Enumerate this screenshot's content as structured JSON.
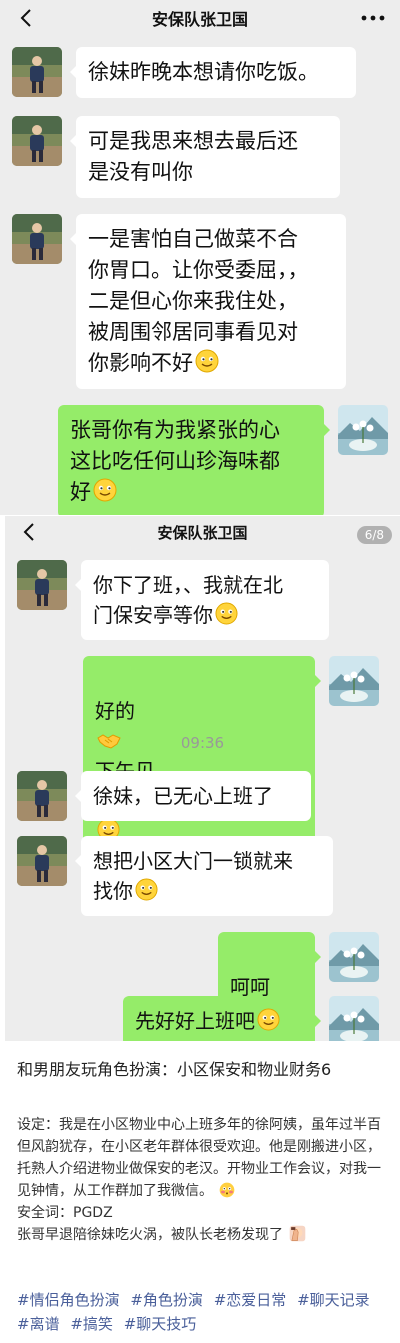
{
  "screenshot1": {
    "title": "安保队张卫国",
    "messages": [
      {
        "side": "left",
        "text": "徐妹昨晚本想请你吃饭。"
      },
      {
        "side": "left",
        "text": "可是我思来想去最后还\n是没有叫你"
      },
      {
        "side": "left",
        "text": "一是害怕自己做菜不合\n你胃口。让你受委屈，，\n二是但心你来我住处，\n被周围邻居同事看见对\n你影响不好"
      },
      {
        "side": "right",
        "text": "张哥你有为我紧张的心\n这比吃任何山珍海味都\n好"
      }
    ]
  },
  "screenshot2": {
    "title": "安保队张卫国",
    "counter": "6/8",
    "time": "09:36",
    "messages": [
      {
        "side": "left",
        "text": "你下了班，、我就在北\n门保安亭等你"
      },
      {
        "side": "right",
        "text": "好的",
        "text_after": "下午见"
      },
      {
        "side": "left",
        "text": "徐妹，已无心上班了"
      },
      {
        "side": "left",
        "text": "想把小区大门一锁就来\n找你"
      },
      {
        "side": "right",
        "text": "呵呵"
      },
      {
        "side": "right",
        "text": "先好好上班吧"
      }
    ]
  },
  "post": {
    "title": "和男朋友玩角色扮演：小区保安和物业财务6",
    "body1": "设定：我是在小区物业中心上班多年的徐阿姨，虽年过半百但风韵犹存，在小区老年群体很受欢迎。他是刚搬进小区，托熟人介绍进物业做保安的老汉。开物业工作会议，对我一见钟情，从工作群加了我微信。",
    "body2": "安全词：PGDZ",
    "body3": "张哥早退陪徐妹吃火涡，被队长老杨发现了",
    "tags": [
      "#情侣角色扮演",
      "#角色扮演",
      "#恋爱日常",
      "#聊天记录",
      "#离谱",
      "#搞笑",
      "#聊天技巧"
    ]
  },
  "colors": {
    "chat_bg": "#ededed",
    "bubble_self": "#95ec69",
    "bubble_other": "#ffffff",
    "tag": "#4a5f9a"
  },
  "icons": [
    "back-chevron-icon",
    "more-dots-icon",
    "smile-emoji",
    "handshake-emoji",
    "tulip-emoji",
    "thinking-emoji",
    "flushed-emoji",
    "facepalm-emoji"
  ]
}
